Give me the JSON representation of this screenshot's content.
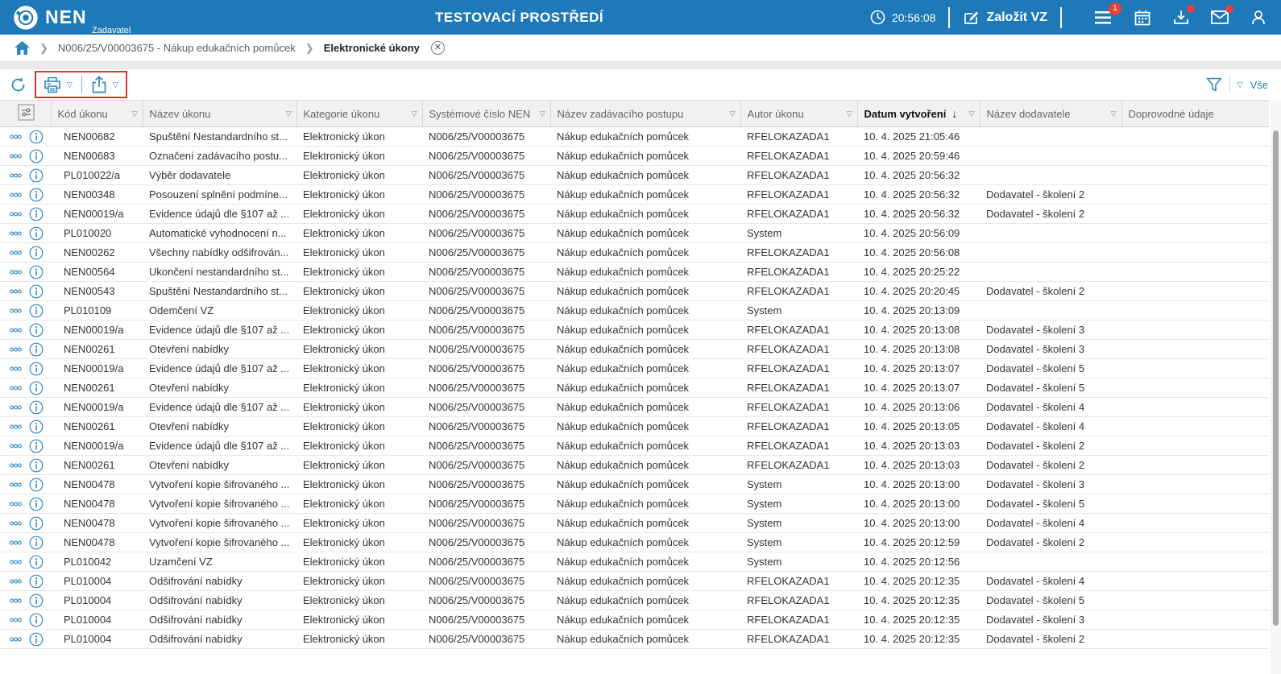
{
  "header": {
    "brand": "NEN",
    "brand_subtitle": "Zadavatel",
    "environment_title": "TESTOVACÍ PROSTŘEDÍ",
    "clock_time": "20:56:08",
    "create_vz_label": "Založit VZ",
    "menu_badge_count": "1"
  },
  "breadcrumb": {
    "procurement_label": "N006/25/V00003675 - Nákup edukačních pomůcek",
    "page_label": "Elektronické úkony"
  },
  "toolbar": {
    "filter_all_label": "Vše"
  },
  "colors": {
    "header_blue": "#1d79b7",
    "accent_blue": "#2e86c1",
    "badge_red": "#e8403a",
    "annotation_red": "#e1312f"
  },
  "table": {
    "columns": [
      {
        "label": "Kód úkonu",
        "filter": true,
        "sorted": false
      },
      {
        "label": "Název úkonu",
        "filter": true,
        "sorted": false
      },
      {
        "label": "Kategorie úkonu",
        "filter": true,
        "sorted": false
      },
      {
        "label": "Systémové číslo NEN",
        "filter": true,
        "sorted": false
      },
      {
        "label": "Název zadávacího postupu",
        "filter": true,
        "sorted": false
      },
      {
        "label": "Autor úkonu",
        "filter": true,
        "sorted": false
      },
      {
        "label": "Datum vytvoření",
        "filter": true,
        "sorted": true
      },
      {
        "label": "Název dodavatele",
        "filter": true,
        "sorted": false
      },
      {
        "label": "Doprovodné údaje",
        "filter": false,
        "sorted": false
      }
    ],
    "rows": [
      {
        "code": "NEN00682",
        "name": "Spuštění Nestandardního st...",
        "category": "Elektronický úkon",
        "nen_number": "N006/25/V00003675",
        "procedure": "Nákup edukačních pomůcek",
        "author": "RFELOKAZADA1",
        "created": "10. 4. 2025 21:05:46",
        "supplier": "",
        "extra": ""
      },
      {
        "code": "NEN00683",
        "name": "Označení zadávacího postu...",
        "category": "Elektronický úkon",
        "nen_number": "N006/25/V00003675",
        "procedure": "Nákup edukačních pomůcek",
        "author": "RFELOKAZADA1",
        "created": "10. 4. 2025 20:59:46",
        "supplier": "",
        "extra": ""
      },
      {
        "code": "PL010022/a",
        "name": "Výběr dodavatele",
        "category": "Elektronický úkon",
        "nen_number": "N006/25/V00003675",
        "procedure": "Nákup edukačních pomůcek",
        "author": "RFELOKAZADA1",
        "created": "10. 4. 2025 20:56:32",
        "supplier": "",
        "extra": ""
      },
      {
        "code": "NEN00348",
        "name": "Posouzení splnění podmíne...",
        "category": "Elektronický úkon",
        "nen_number": "N006/25/V00003675",
        "procedure": "Nákup edukačních pomůcek",
        "author": "RFELOKAZADA1",
        "created": "10. 4. 2025 20:56:32",
        "supplier": "Dodavatel - školení 2",
        "extra": ""
      },
      {
        "code": "NEN00019/a",
        "name": "Evidence údajů dle §107 až ...",
        "category": "Elektronický úkon",
        "nen_number": "N006/25/V00003675",
        "procedure": "Nákup edukačních pomůcek",
        "author": "RFELOKAZADA1",
        "created": "10. 4. 2025 20:56:32",
        "supplier": "Dodavatel - školení 2",
        "extra": ""
      },
      {
        "code": "PL010020",
        "name": "Automatické vyhodnocení n...",
        "category": "Elektronický úkon",
        "nen_number": "N006/25/V00003675",
        "procedure": "Nákup edukačních pomůcek",
        "author": "System",
        "created": "10. 4. 2025 20:56:09",
        "supplier": "",
        "extra": ""
      },
      {
        "code": "NEN00262",
        "name": "Všechny nabídky odšifrován...",
        "category": "Elektronický úkon",
        "nen_number": "N006/25/V00003675",
        "procedure": "Nákup edukačních pomůcek",
        "author": "RFELOKAZADA1",
        "created": "10. 4. 2025 20:56:08",
        "supplier": "",
        "extra": ""
      },
      {
        "code": "NEN00564",
        "name": "Ukončení nestandardního st...",
        "category": "Elektronický úkon",
        "nen_number": "N006/25/V00003675",
        "procedure": "Nákup edukačních pomůcek",
        "author": "RFELOKAZADA1",
        "created": "10. 4. 2025 20:25:22",
        "supplier": "",
        "extra": ""
      },
      {
        "code": "NEN00543",
        "name": "Spuštění Nestandardního st...",
        "category": "Elektronický úkon",
        "nen_number": "N006/25/V00003675",
        "procedure": "Nákup edukačních pomůcek",
        "author": "RFELOKAZADA1",
        "created": "10. 4. 2025 20:20:45",
        "supplier": "Dodavatel - školení 2",
        "extra": ""
      },
      {
        "code": "PL010109",
        "name": "Odemčení VZ",
        "category": "Elektronický úkon",
        "nen_number": "N006/25/V00003675",
        "procedure": "Nákup edukačních pomůcek",
        "author": "System",
        "created": "10. 4. 2025 20:13:09",
        "supplier": "",
        "extra": ""
      },
      {
        "code": "NEN00019/a",
        "name": "Evidence údajů dle §107 až ...",
        "category": "Elektronický úkon",
        "nen_number": "N006/25/V00003675",
        "procedure": "Nákup edukačních pomůcek",
        "author": "RFELOKAZADA1",
        "created": "10. 4. 2025 20:13:08",
        "supplier": "Dodavatel - školení 3",
        "extra": ""
      },
      {
        "code": "NEN00261",
        "name": "Otevření nabídky",
        "category": "Elektronický úkon",
        "nen_number": "N006/25/V00003675",
        "procedure": "Nákup edukačních pomůcek",
        "author": "RFELOKAZADA1",
        "created": "10. 4. 2025 20:13:08",
        "supplier": "Dodavatel - školení 3",
        "extra": ""
      },
      {
        "code": "NEN00019/a",
        "name": "Evidence údajů dle §107 až ...",
        "category": "Elektronický úkon",
        "nen_number": "N006/25/V00003675",
        "procedure": "Nákup edukačních pomůcek",
        "author": "RFELOKAZADA1",
        "created": "10. 4. 2025 20:13:07",
        "supplier": "Dodavatel - školení 5",
        "extra": ""
      },
      {
        "code": "NEN00261",
        "name": "Otevření nabídky",
        "category": "Elektronický úkon",
        "nen_number": "N006/25/V00003675",
        "procedure": "Nákup edukačních pomůcek",
        "author": "RFELOKAZADA1",
        "created": "10. 4. 2025 20:13:07",
        "supplier": "Dodavatel - školení 5",
        "extra": ""
      },
      {
        "code": "NEN00019/a",
        "name": "Evidence údajů dle §107 až ...",
        "category": "Elektronický úkon",
        "nen_number": "N006/25/V00003675",
        "procedure": "Nákup edukačních pomůcek",
        "author": "RFELOKAZADA1",
        "created": "10. 4. 2025 20:13:06",
        "supplier": "Dodavatel - školení 4",
        "extra": ""
      },
      {
        "code": "NEN00261",
        "name": "Otevření nabídky",
        "category": "Elektronický úkon",
        "nen_number": "N006/25/V00003675",
        "procedure": "Nákup edukačních pomůcek",
        "author": "RFELOKAZADA1",
        "created": "10. 4. 2025 20:13:05",
        "supplier": "Dodavatel - školení 4",
        "extra": ""
      },
      {
        "code": "NEN00019/a",
        "name": "Evidence údajů dle §107 až ...",
        "category": "Elektronický úkon",
        "nen_number": "N006/25/V00003675",
        "procedure": "Nákup edukačních pomůcek",
        "author": "RFELOKAZADA1",
        "created": "10. 4. 2025 20:13:03",
        "supplier": "Dodavatel - školení 2",
        "extra": ""
      },
      {
        "code": "NEN00261",
        "name": "Otevření nabídky",
        "category": "Elektronický úkon",
        "nen_number": "N006/25/V00003675",
        "procedure": "Nákup edukačních pomůcek",
        "author": "RFELOKAZADA1",
        "created": "10. 4. 2025 20:13:03",
        "supplier": "Dodavatel - školení 2",
        "extra": ""
      },
      {
        "code": "NEN00478",
        "name": "Vytvoření kopie šifrovaného ...",
        "category": "Elektronický úkon",
        "nen_number": "N006/25/V00003675",
        "procedure": "Nákup edukačních pomůcek",
        "author": "System",
        "created": "10. 4. 2025 20:13:00",
        "supplier": "Dodavatel - školení 3",
        "extra": ""
      },
      {
        "code": "NEN00478",
        "name": "Vytvoření kopie šifrovaného ...",
        "category": "Elektronický úkon",
        "nen_number": "N006/25/V00003675",
        "procedure": "Nákup edukačních pomůcek",
        "author": "System",
        "created": "10. 4. 2025 20:13:00",
        "supplier": "Dodavatel - školení 5",
        "extra": ""
      },
      {
        "code": "NEN00478",
        "name": "Vytvoření kopie šifrovaného ...",
        "category": "Elektronický úkon",
        "nen_number": "N006/25/V00003675",
        "procedure": "Nákup edukačních pomůcek",
        "author": "System",
        "created": "10. 4. 2025 20:13:00",
        "supplier": "Dodavatel - školení 4",
        "extra": ""
      },
      {
        "code": "NEN00478",
        "name": "Vytvoření kopie šifrovaného ...",
        "category": "Elektronický úkon",
        "nen_number": "N006/25/V00003675",
        "procedure": "Nákup edukačních pomůcek",
        "author": "System",
        "created": "10. 4. 2025 20:12:59",
        "supplier": "Dodavatel - školení 2",
        "extra": ""
      },
      {
        "code": "PL010042",
        "name": "Uzamčení VZ",
        "category": "Elektronický úkon",
        "nen_number": "N006/25/V00003675",
        "procedure": "Nákup edukačních pomůcek",
        "author": "System",
        "created": "10. 4. 2025 20:12:56",
        "supplier": "",
        "extra": ""
      },
      {
        "code": "PL010004",
        "name": "Odšifrování nabídky",
        "category": "Elektronický úkon",
        "nen_number": "N006/25/V00003675",
        "procedure": "Nákup edukačních pomůcek",
        "author": "RFELOKAZADA1",
        "created": "10. 4. 2025 20:12:35",
        "supplier": "Dodavatel - školení 4",
        "extra": ""
      },
      {
        "code": "PL010004",
        "name": "Odšifrování nabídky",
        "category": "Elektronický úkon",
        "nen_number": "N006/25/V00003675",
        "procedure": "Nákup edukačních pomůcek",
        "author": "RFELOKAZADA1",
        "created": "10. 4. 2025 20:12:35",
        "supplier": "Dodavatel - školení 5",
        "extra": ""
      },
      {
        "code": "PL010004",
        "name": "Odšifrování nabídky",
        "category": "Elektronický úkon",
        "nen_number": "N006/25/V00003675",
        "procedure": "Nákup edukačních pomůcek",
        "author": "RFELOKAZADA1",
        "created": "10. 4. 2025 20:12:35",
        "supplier": "Dodavatel - školení 3",
        "extra": ""
      },
      {
        "code": "PL010004",
        "name": "Odšifrování nabídky",
        "category": "Elektronický úkon",
        "nen_number": "N006/25/V00003675",
        "procedure": "Nákup edukačních pomůcek",
        "author": "RFELOKAZADA1",
        "created": "10. 4. 2025 20:12:35",
        "supplier": "Dodavatel - školení 2",
        "extra": ""
      }
    ]
  }
}
